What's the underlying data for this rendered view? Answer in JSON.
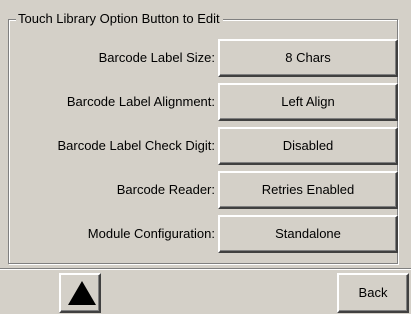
{
  "group_title": "Touch Library Option Button to Edit",
  "options": [
    {
      "label": "Barcode Label Size:",
      "value": "8 Chars"
    },
    {
      "label": "Barcode Label Alignment:",
      "value": "Left Align"
    },
    {
      "label": "Barcode Label Check Digit:",
      "value": "Disabled"
    },
    {
      "label": "Barcode Reader:",
      "value": "Retries Enabled"
    },
    {
      "label": "Module Configuration:",
      "value": "Standalone"
    }
  ],
  "nav": {
    "up_icon": "up-arrow-icon",
    "back_label": "Back"
  }
}
